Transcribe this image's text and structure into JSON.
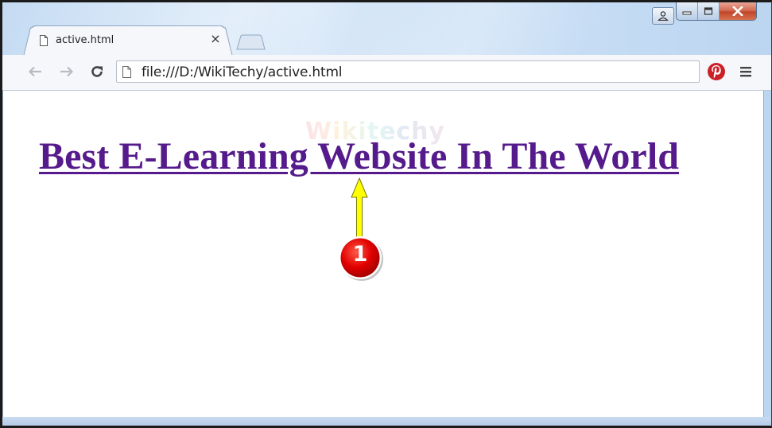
{
  "tab": {
    "title": "active.html",
    "close_symbol": "×"
  },
  "toolbar": {
    "back_icon": "back-arrow-icon",
    "forward_icon": "forward-arrow-icon",
    "reload_icon": "reload-icon",
    "url": "file:///D:/WikiTechy/active.html",
    "extension_icon": "pinterest-icon",
    "menu_icon": "hamburger-menu-icon"
  },
  "window_controls": {
    "user_icon": "user-icon",
    "minimize_icon": "minimize-icon",
    "maximize_icon": "maximize-icon",
    "close_icon": "close-icon"
  },
  "page": {
    "watermark": "Wikitechy",
    "link_text": "Best E-Learning Website In The World",
    "link_color": "#551a8b",
    "callout_number": "1",
    "callout_color": "#e10000",
    "arrow_color": "#ffff00"
  }
}
